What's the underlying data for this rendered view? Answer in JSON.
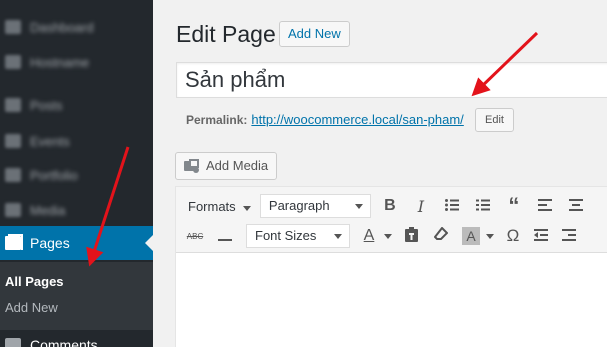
{
  "sidebar": {
    "items": [
      {
        "label": "Dashboard"
      },
      {
        "label": "Hostname"
      },
      {
        "label": "Posts"
      },
      {
        "label": "Events"
      },
      {
        "label": "Portfolio"
      },
      {
        "label": "Media"
      }
    ],
    "active": {
      "label": "Pages"
    },
    "submenu": [
      {
        "label": "All Pages"
      },
      {
        "label": "Add New"
      }
    ],
    "next": {
      "label": "Comments"
    }
  },
  "header": {
    "title": "Edit Page",
    "add_new_label": "Add New"
  },
  "post": {
    "title_value": "Sản phẩm",
    "permalink_label": "Permalink:",
    "permalink_url": "http://woocommerce.local/san-pham/",
    "edit_label": "Edit"
  },
  "editor": {
    "add_media_label": "Add Media",
    "formats_label": "Formats",
    "paragraph_label": "Paragraph",
    "font_sizes_label": "Font Sizes",
    "strike_label": "ABC",
    "omega_label": "Ω",
    "icons": [
      "bold-icon",
      "italic-icon",
      "bullet-list-icon",
      "numbered-list-icon",
      "blockquote-icon",
      "align-left-icon",
      "align-center-icon",
      "strikethrough-icon",
      "horizontal-rule-icon",
      "text-color-icon",
      "paste-text-icon",
      "clear-formatting-icon",
      "background-color-icon",
      "special-character-icon",
      "outdent-icon",
      "indent-icon"
    ]
  },
  "annotations": {
    "arrow_color": "#e3131b"
  },
  "colors": {
    "sidebar_bg": "#23282d",
    "active_bg": "#0073aa",
    "link": "#0073aa"
  }
}
